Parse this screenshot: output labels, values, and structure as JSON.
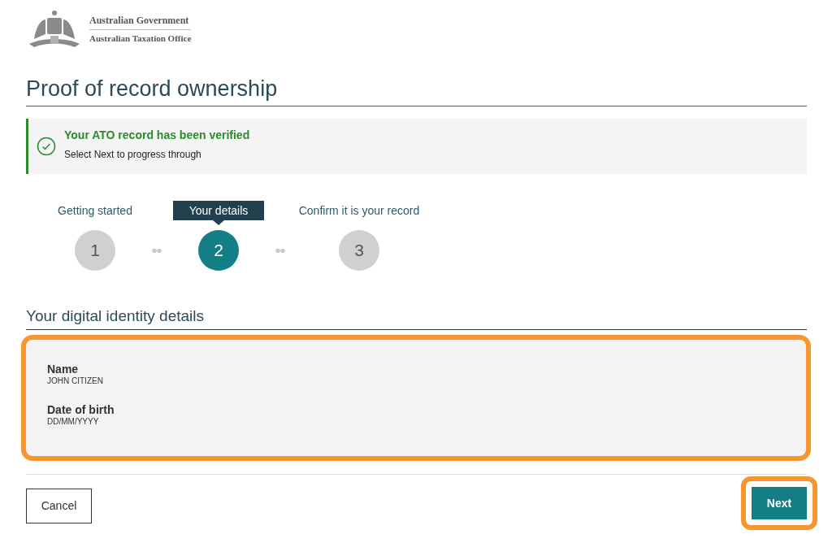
{
  "header": {
    "agency_line_1": "Australian Government",
    "agency_line_2": "Australian Taxation Office"
  },
  "page_title": "Proof of record ownership",
  "alert": {
    "title": "Your ATO record has been verified",
    "message": "Select Next to progress through"
  },
  "steps": [
    {
      "label": "Getting started",
      "number": "1",
      "selected": false
    },
    {
      "label": "Your details",
      "number": "2",
      "selected": true
    },
    {
      "label": "Confirm it is your record",
      "number": "3",
      "selected": false
    }
  ],
  "section_heading": "Your digital identity details",
  "details": {
    "highlighted": true,
    "fields": [
      {
        "label": "Name",
        "value": "JOHN CITIZEN"
      },
      {
        "label": "Date of birth",
        "value": "DD/MM/YYYY"
      }
    ]
  },
  "buttons": [
    {
      "kind": "secondary",
      "label": "Cancel",
      "highlighted": false
    },
    {
      "kind": "primary",
      "label": "Next",
      "highlighted": true
    }
  ]
}
